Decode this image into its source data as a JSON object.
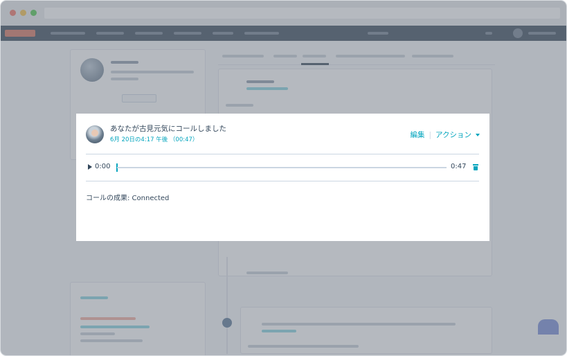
{
  "modal": {
    "title": "あなたが古見元気にコールしました",
    "subtitle": "6月 20日の4:17 午後 （00:47）",
    "actions": {
      "edit_label": "編集",
      "separator": "|",
      "action_label": "アクション"
    },
    "player": {
      "current_time": "0:00",
      "duration": "0:47",
      "progress": 0
    },
    "outcome": "コールの成果: Connected"
  },
  "colors": {
    "accent": "#00a4bd",
    "text": "#33475b",
    "divider": "#cbd6e2",
    "nav": "#2d3e50"
  },
  "icons": {
    "play": "play-icon",
    "delete": "trash-icon",
    "dropdown": "chevron-down-icon"
  }
}
